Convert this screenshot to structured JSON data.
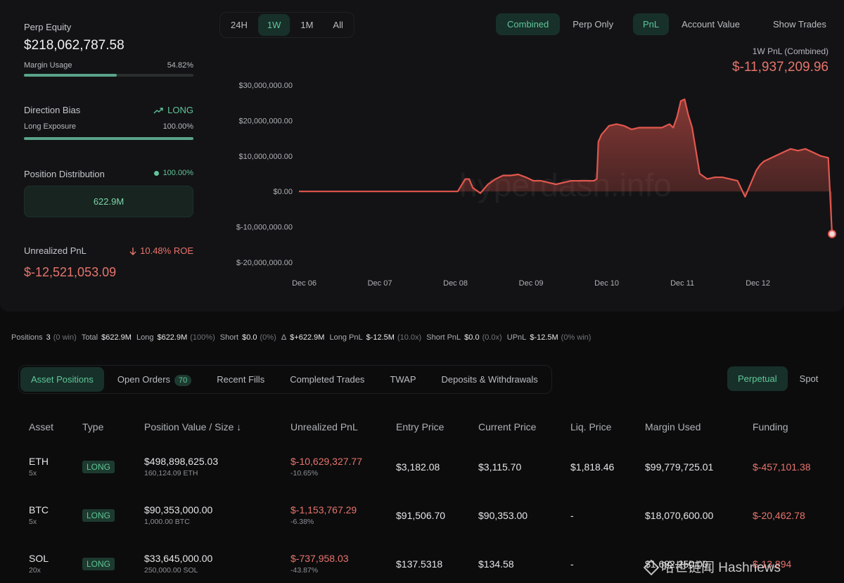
{
  "summary": {
    "perp_equity_label": "Perp Equity",
    "perp_equity_value": "$218,062,787.58",
    "margin_usage_label": "Margin Usage",
    "margin_usage_value": "54.82%",
    "margin_usage_fraction": 0.5482,
    "direction_bias_label": "Direction Bias",
    "direction_bias_value": "LONG",
    "long_exposure_label": "Long Exposure",
    "long_exposure_value": "100.00%",
    "long_exposure_fraction": 1.0,
    "position_distribution_label": "Position Distribution",
    "position_distribution_value": "100.00%",
    "position_distribution_amount": "622.9M",
    "unrealized_pnl_label": "Unrealized PnL",
    "roe_value": "10.48% ROE",
    "unrealized_pnl_value": "$-12,521,053.09"
  },
  "timeframes": [
    "24H",
    "1W",
    "1M",
    "All"
  ],
  "active_timeframe": "1W",
  "chart_controls": {
    "combined": "Combined",
    "perp_only": "Perp Only",
    "pnl": "PnL",
    "account_value": "Account Value",
    "show_trades": "Show Trades"
  },
  "chart_header": {
    "label": "1W PnL (Combined)",
    "value": "$-11,937,209.96"
  },
  "colors": {
    "accent_green": "#5dc79a",
    "loss_red": "#e8746c",
    "line_red": "#e2574e"
  },
  "chart_data": {
    "type": "area",
    "ytick_labels": [
      "$30,000,000.00",
      "$20,000,000.00",
      "$10,000,000.00",
      "$0.00",
      "$-10,000,000.00",
      "$-20,000,000.00"
    ],
    "yticks": [
      30000000,
      20000000,
      10000000,
      0,
      -10000000,
      -20000000
    ],
    "ylim": [
      -20000000,
      30000000
    ],
    "xtick_labels": [
      "Dec 06",
      "Dec 07",
      "Dec 08",
      "Dec 09",
      "Dec 10",
      "Dec 11",
      "Dec 12"
    ],
    "xticks": [
      0.07,
      1.07,
      2.07,
      3.07,
      4.07,
      5.07,
      6.07
    ],
    "xlim": [
      0,
      7.05
    ],
    "watermark": "hyperdash.info",
    "x": [
      0,
      1.9,
      2.0,
      2.1,
      2.2,
      2.25,
      2.3,
      2.4,
      2.5,
      2.6,
      2.7,
      2.8,
      2.9,
      3.0,
      3.1,
      3.2,
      3.3,
      3.4,
      3.5,
      3.6,
      3.7,
      3.8,
      3.9,
      3.94,
      3.96,
      4.0,
      4.1,
      4.2,
      4.3,
      4.4,
      4.5,
      4.6,
      4.7,
      4.8,
      4.9,
      4.95,
      5.0,
      5.05,
      5.1,
      5.15,
      5.2,
      5.3,
      5.4,
      5.5,
      5.6,
      5.7,
      5.8,
      5.9,
      6.0,
      6.05,
      6.1,
      6.15,
      6.2,
      6.3,
      6.4,
      6.5,
      6.6,
      6.7,
      6.8,
      6.9,
      7.0,
      7.05
    ],
    "y": [
      0,
      0,
      0,
      0,
      3500000,
      3500000,
      1000000,
      -500000,
      2000000,
      3500000,
      4500000,
      4500000,
      4800000,
      4000000,
      3000000,
      3000000,
      2500000,
      2000000,
      2500000,
      3000000,
      3000000,
      3000000,
      3000000,
      3500000,
      14000000,
      16000000,
      18500000,
      19000000,
      18500000,
      17500000,
      18000000,
      18000000,
      18000000,
      18000000,
      19000000,
      18000000,
      21000000,
      25500000,
      26000000,
      21500000,
      18000000,
      5000000,
      3500000,
      4000000,
      4000000,
      3500000,
      3000000,
      -1500000,
      3500000,
      6000000,
      7500000,
      8500000,
      9000000,
      10000000,
      11000000,
      12000000,
      11500000,
      12000000,
      11000000,
      10000000,
      9500000,
      -12000000
    ]
  },
  "stats": {
    "positions_label": "Positions",
    "positions_value": "3",
    "positions_sub": "(0 win)",
    "total_label": "Total",
    "total_value": "$622.9M",
    "long_label": "Long",
    "long_value": "$622.9M",
    "long_sub": "(100%)",
    "short_label": "Short",
    "short_value": "$0.0",
    "short_sub": "(0%)",
    "delta_label": "Δ",
    "delta_value": "$+622.9M",
    "long_pnl_label": "Long PnL",
    "long_pnl_value": "$-12.5M",
    "long_pnl_sub": "(10.0x)",
    "short_pnl_label": "Short PnL",
    "short_pnl_value": "$0.0",
    "short_pnl_sub": "(0.0x)",
    "upnl_label": "UPnL",
    "upnl_value": "$-12.5M",
    "upnl_sub": "(0% win)"
  },
  "tabs": {
    "asset_positions": "Asset Positions",
    "open_orders": "Open Orders",
    "open_orders_count": "70",
    "recent_fills": "Recent Fills",
    "completed_trades": "Completed Trades",
    "twap": "TWAP",
    "deposits": "Deposits & Withdrawals",
    "perpetual": "Perpetual",
    "spot": "Spot"
  },
  "table": {
    "headers": [
      "Asset",
      "Type",
      "Position Value / Size ↓",
      "Unrealized PnL",
      "Entry Price",
      "Current Price",
      "Liq. Price",
      "Margin Used",
      "Funding"
    ],
    "rows": [
      {
        "asset": "ETH",
        "leverage": "5x",
        "type": "LONG",
        "value": "$498,898,625.03",
        "size": "160,124.09 ETH",
        "pnl": "$-10,629,327.77",
        "pnl_pct": "-10.65%",
        "entry": "$3,182.08",
        "current": "$3,115.70",
        "liq": "$1,818.46",
        "margin": "$99,779,725.01",
        "funding": "$-457,101.38"
      },
      {
        "asset": "BTC",
        "leverage": "5x",
        "type": "LONG",
        "value": "$90,353,000.00",
        "size": "1,000.00 BTC",
        "pnl": "$-1,153,767.29",
        "pnl_pct": "-6.38%",
        "entry": "$91,506.70",
        "current": "$90,353.00",
        "liq": "-",
        "margin": "$18,070,600.00",
        "funding": "$-20,462.78"
      },
      {
        "asset": "SOL",
        "leverage": "20x",
        "type": "LONG",
        "value": "$33,645,000.00",
        "size": "250,000.00 SOL",
        "pnl": "$-737,958.03",
        "pnl_pct": "-43.87%",
        "entry": "$137.5318",
        "current": "$134.58",
        "liq": "-",
        "margin": "$1,682,250.00",
        "funding": "$-13,894"
      }
    ]
  },
  "watermark_text": "哈世链闻 Hashnews"
}
